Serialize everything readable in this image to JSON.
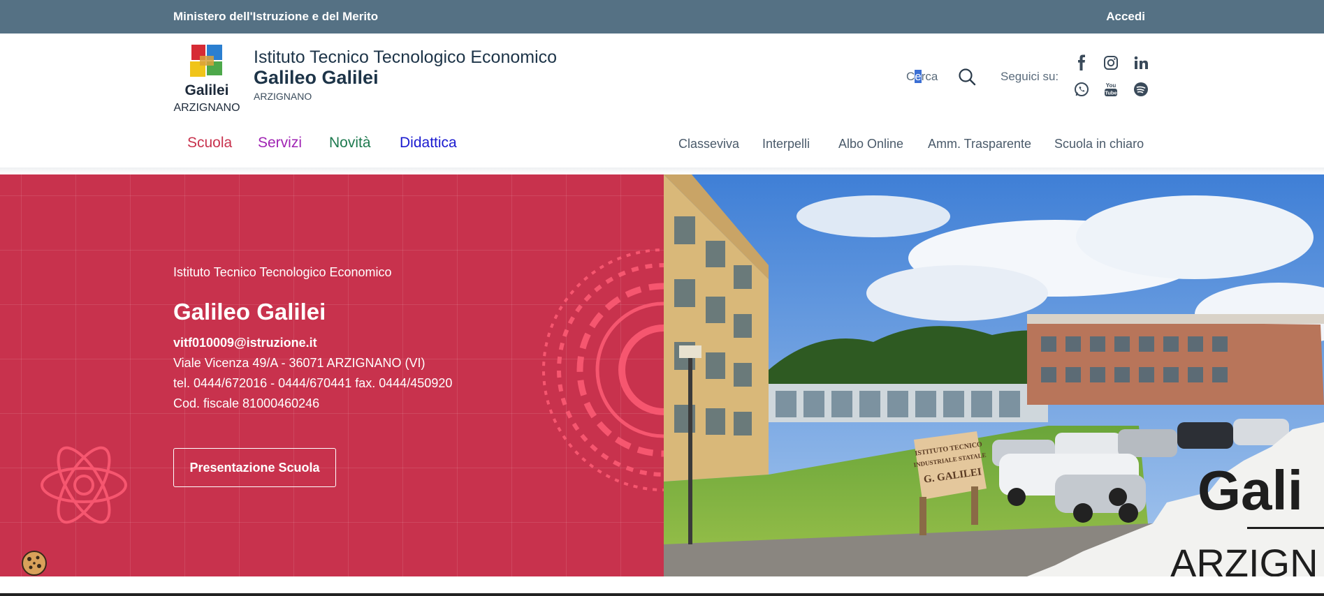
{
  "topbar": {
    "ministry": "Ministero dell'Istruzione e del Merito",
    "login": "Accedi"
  },
  "logo": {
    "name": "Galilei",
    "city": "ARZIGNANO"
  },
  "brand": {
    "line1": "Istituto Tecnico Tecnologico Economico",
    "line2": "Galileo Galilei",
    "line3": "ARZIGNANO"
  },
  "search": {
    "label_pre": "C",
    "label_cursor": "e",
    "label_post": "rca",
    "icon": "search-icon"
  },
  "social": {
    "follow_label": "Seguici su:",
    "icons": [
      "facebook-icon",
      "instagram-icon",
      "linkedin-icon",
      "whatsapp-icon",
      "youtube-icon",
      "spotify-icon"
    ]
  },
  "mainnav": [
    {
      "label": "Scuola",
      "color": "#c8324d"
    },
    {
      "label": "Servizi",
      "color": "#a024b4"
    },
    {
      "label": "Novità",
      "color": "#1e7a4f"
    },
    {
      "label": "Didattica",
      "color": "#1a1ad0"
    }
  ],
  "secnav": [
    "Classeviva",
    "Interpelli",
    "Albo Online",
    "Amm. Trasparente",
    "Scuola in chiaro"
  ],
  "hero": {
    "subtitle": "Istituto Tecnico Tecnologico Economico",
    "title": "Galileo Galilei",
    "email": "vitf010009@istruzione.it",
    "address": "Viale Vicenza 49/A - 36071 ARZIGNANO (VI)",
    "phone": "tel. 0444/672016 - 0444/670441 fax. 0444/450920",
    "tax": "Cod. fiscale 81000460246",
    "button": "Presentazione Scuola",
    "bg_color": "#c8324d"
  },
  "photo": {
    "sign_line1": "ISTITUTO TECNICO",
    "sign_line2": "INDUSTRIALE STATALE",
    "sign_line3": "G. GALILEI",
    "overlay_text1": "Gali",
    "overlay_text2": "ARZIGN"
  },
  "colors": {
    "topbar": "#557184",
    "accent": "#c8324d",
    "primary_text": "#1d3448"
  }
}
